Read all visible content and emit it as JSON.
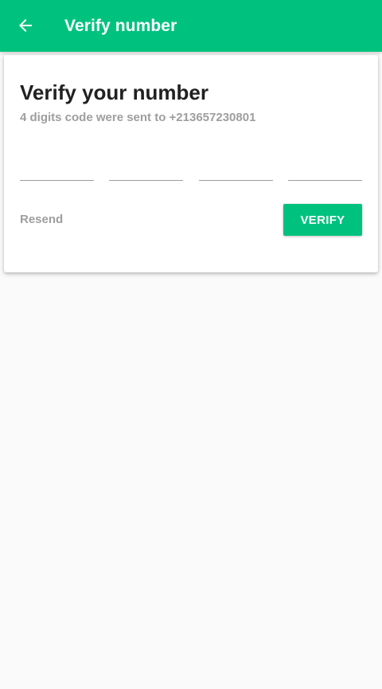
{
  "colors": {
    "accent": "#00c27f",
    "title_text": "#212121",
    "secondary_text": "#9e9e9e",
    "background": "#fafafa",
    "card": "#ffffff"
  },
  "app_bar": {
    "back_icon": "arrow-back-icon",
    "title": "Verify number"
  },
  "card": {
    "title": "Verify your number",
    "subtitle": "4 digits code were sent to +213657230801",
    "code_fields": [
      {
        "value": "",
        "placeholder": ""
      },
      {
        "value": "",
        "placeholder": ""
      },
      {
        "value": "",
        "placeholder": ""
      },
      {
        "value": "",
        "placeholder": ""
      }
    ],
    "resend_label": "Resend",
    "verify_label": "VERIFY"
  }
}
